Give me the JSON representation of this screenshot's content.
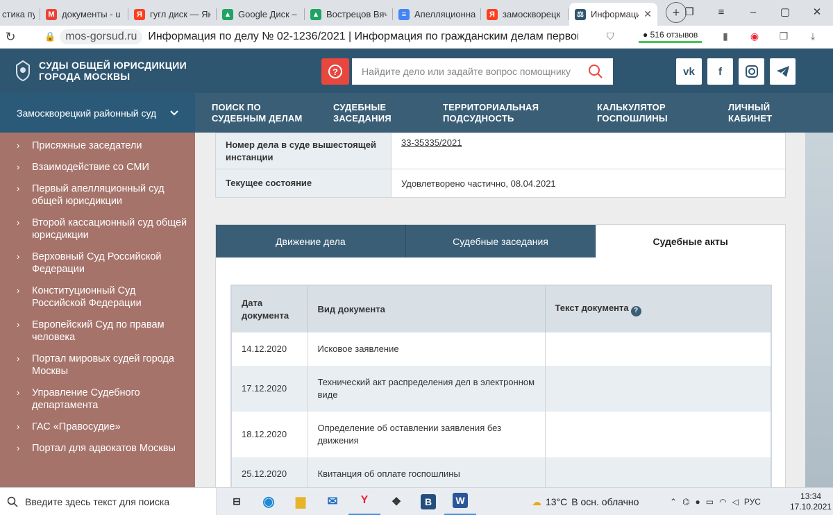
{
  "browser": {
    "tabs": [
      {
        "label": "стика пус",
        "fav": "",
        "color": "#dee1e6"
      },
      {
        "label": "документы - u",
        "fav": "M",
        "color": "#ea4335"
      },
      {
        "label": "гугл диск — Ян",
        "fav": "Я",
        "color": "#fc3f1d"
      },
      {
        "label": "Google Диск –",
        "fav": "▲",
        "color": "#1fa463"
      },
      {
        "label": "Вострецов Вяч",
        "fav": "▲",
        "color": "#1fa463"
      },
      {
        "label": "Апелляционна",
        "fav": "≡",
        "color": "#4285f4"
      },
      {
        "label": "замоскворецк",
        "fav": "Я",
        "color": "#fc3f1d"
      },
      {
        "label": "Информаци",
        "fav": "⚖",
        "color": "#2f5670",
        "active": true
      }
    ],
    "close_glyph": "✕",
    "new_tab": "+",
    "domain": "mos-gorsud.ru",
    "page_title": "Информация по делу № 02-1236/2021 | Информация по гражданским делам первой...",
    "reviews": "516 отзывов"
  },
  "site": {
    "logo_line1": "СУДЫ ОБЩЕЙ ЮРИСДИКЦИИ",
    "logo_line2": "ГОРОДА МОСКВЫ",
    "search_placeholder": "Найдите дело или задайте вопрос помощнику",
    "help_glyph": "?",
    "social": [
      "vk",
      "f",
      "ig",
      "tg"
    ],
    "court": "Замоскворецкий районный суд",
    "nav": [
      {
        "line1": "ПОИСК ПО",
        "line2": "СУДЕБНЫМ ДЕЛАМ"
      },
      {
        "line1": "СУДЕБНЫЕ",
        "line2": "ЗАСЕДАНИЯ"
      },
      {
        "line1": "ТЕРРИТОРИАЛЬНАЯ",
        "line2": "ПОДСУДНОСТЬ"
      },
      {
        "line1": "КАЛЬКУЛЯТОР",
        "line2": "ГОСПОШЛИНЫ"
      },
      {
        "line1": "ЛИЧНЫЙ",
        "line2": "КАБИНЕТ"
      }
    ]
  },
  "sidebar": {
    "items": [
      "Присяжные заседатели",
      "Взаимодействие со СМИ",
      "Первый апелляционный суд общей юрисдикции",
      "Второй кассационный суд общей юрисдикции",
      "Верховный Суд Российской Федерации",
      "Конституционный Суд Российской Федерации",
      "Европейский Суд по правам человека",
      "Портал мировых судей города Москвы",
      "Управление Судебного департамента",
      "ГАС «Правосудие»",
      "Портал для адвокатов Москвы"
    ]
  },
  "case_info": {
    "higher_label": "Номер дела в суде вышестоящей инстанции",
    "higher_value": "33-35335/2021",
    "state_label": "Текущее состояние",
    "state_value": "Удовлетворено частично, 08.04.2021"
  },
  "panel": {
    "tabs": [
      "Движение дела",
      "Судебные заседания",
      "Судебные акты"
    ],
    "headers": {
      "date": "Дата документа",
      "type": "Вид документа",
      "text": "Текст документа"
    },
    "help_glyph": "?",
    "rows": [
      {
        "date": "14.12.2020",
        "type": "Исковое заявление"
      },
      {
        "date": "17.12.2020",
        "type": "Технический акт распределения дел в электронном виде"
      },
      {
        "date": "18.12.2020",
        "type": "Определение об оставлении заявления без движения"
      },
      {
        "date": "25.12.2020",
        "type": "Квитанция об оплате госпошлины"
      }
    ]
  },
  "taskbar": {
    "search_placeholder": "Введите здесь текст для поиска",
    "temperature": "13°C",
    "weather": "В осн. облачно",
    "lang": "РУС",
    "time": "13:34",
    "date": "17.10.2021"
  }
}
